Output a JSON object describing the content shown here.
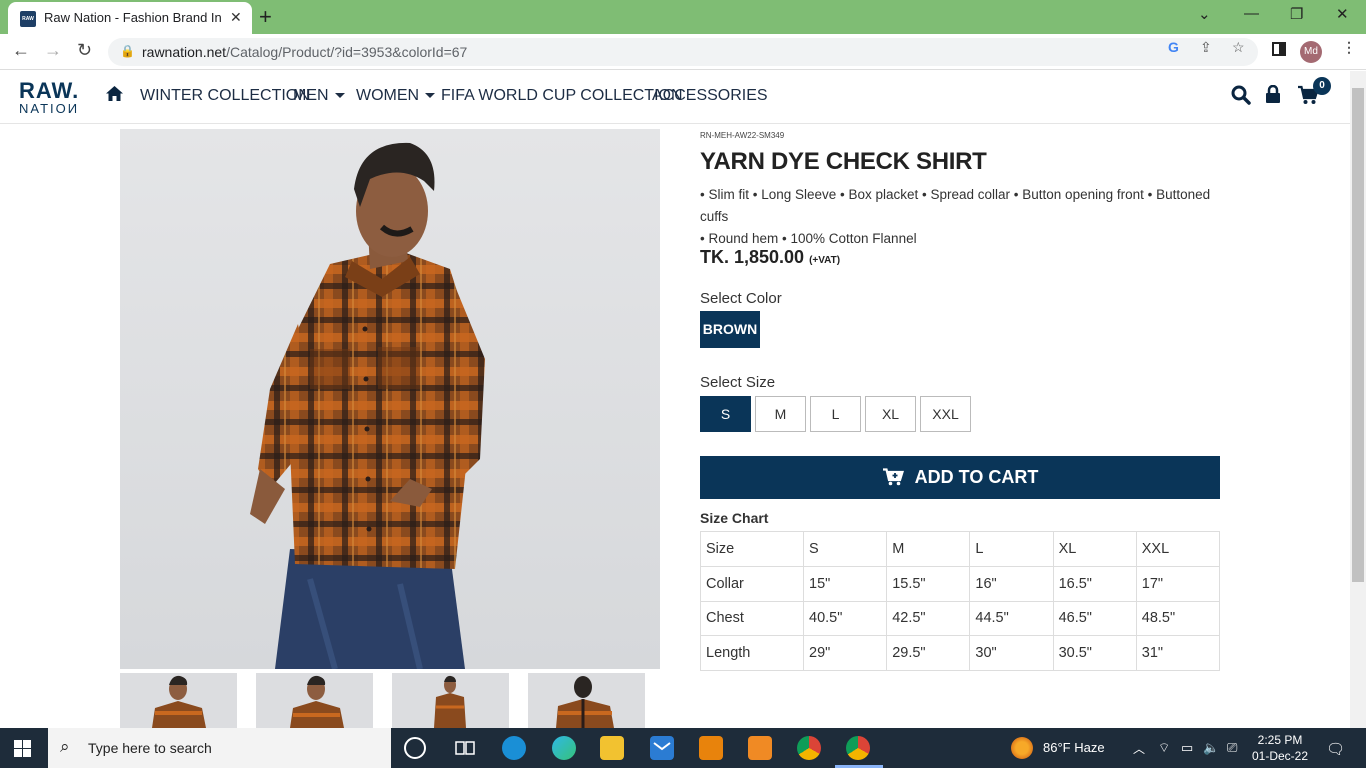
{
  "browser": {
    "tab_title": "Raw Nation - Fashion Brand In Ba",
    "url_host": "rawnation.net",
    "url_path": "/Catalog/Product/?id=3953&colorId=67",
    "profile_initials": "Md"
  },
  "site": {
    "logo_top": "RAW.",
    "logo_bottom": "NATIOИ",
    "nav": [
      "WINTER COLLECTION",
      "MEN",
      "WOMEN",
      "FIFA WORLD CUP COLLECTION",
      "ACCESSORIES"
    ],
    "cart_count": "0"
  },
  "product": {
    "sku": "RN-MEH-AW22-SM349",
    "title": "YARN DYE CHECK SHIRT",
    "desc_line1": "• Slim fit • Long Sleeve • Box placket • Spread collar • Button opening front • Buttoned cuffs",
    "desc_line2": "• Round hem • 100% Cotton Flannel",
    "price": "TK. 1,850.00",
    "vat": "(+VAT)",
    "select_color_label": "Select Color",
    "color": "BROWN",
    "select_size_label": "Select Size",
    "sizes": [
      "S",
      "M",
      "L",
      "XL",
      "XXL"
    ],
    "selected_size": "S",
    "add_to_cart": "ADD TO CART",
    "size_chart_label": "Size Chart",
    "size_chart": [
      [
        "Size",
        "S",
        "M",
        "L",
        "XL",
        "XXL"
      ],
      [
        "Collar",
        "15\"",
        "15.5\"",
        "16\"",
        "16.5\"",
        "17\""
      ],
      [
        "Chest",
        "40.5\"",
        "42.5\"",
        "44.5\"",
        "46.5\"",
        "48.5\""
      ],
      [
        "Length",
        "29\"",
        "29.5\"",
        "30\"",
        "30.5\"",
        "31\""
      ]
    ]
  },
  "taskbar": {
    "search_placeholder": "Type here to search",
    "weather": "86°F  Haze",
    "time": "2:25 PM",
    "date": "01-Dec-22"
  },
  "colors": {
    "brand_navy": "#0a3558",
    "tabbar_green": "#7fbd74"
  }
}
